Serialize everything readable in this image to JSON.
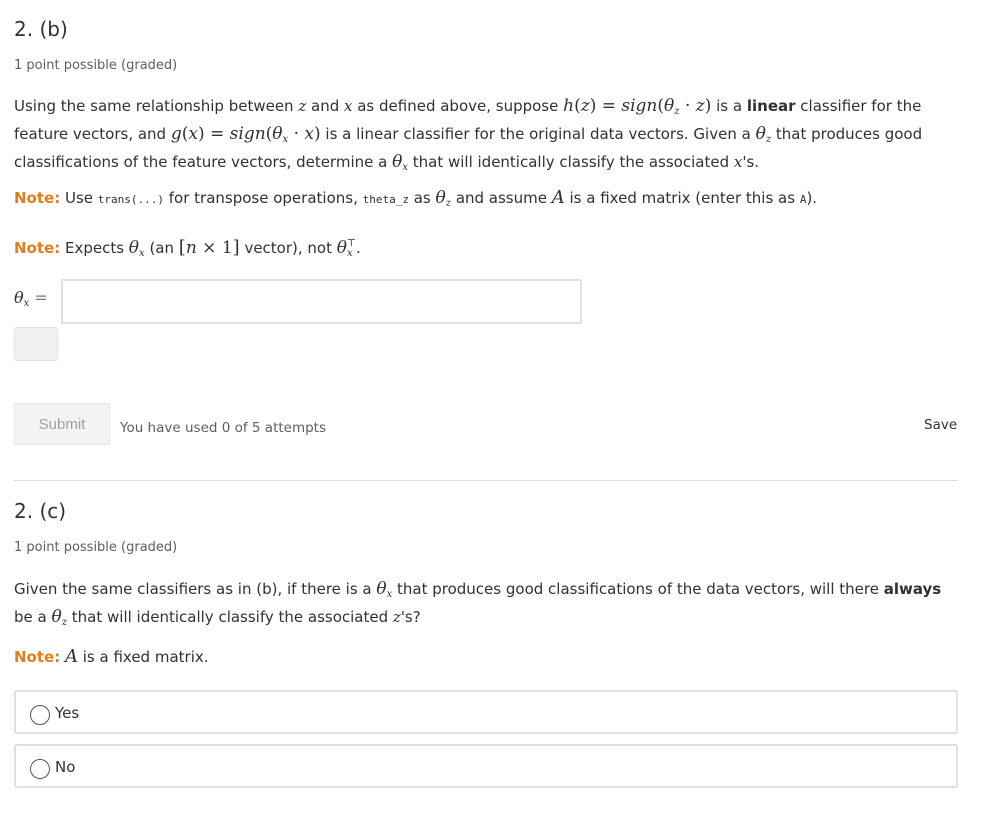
{
  "part_b": {
    "title": "2. (b)",
    "points": "1 point possible (graded)",
    "para": {
      "t1": "Using the same relationship between ",
      "t2": " and ",
      "t3": " as defined above, suppose ",
      "t4": " is a ",
      "bold1": "linear",
      "t5": " classifier for the feature vectors, and ",
      "t6": " is a linear classifier for the original data vectors. Given a ",
      "t7": " that produces good classifications of the feature vectors, determine a ",
      "t8": " that will identically classify the associated ",
      "t9": "'s."
    },
    "note1": {
      "label": "Note:",
      "t1": " Use ",
      "code1": "trans(...)",
      "t2": " for transpose operations, ",
      "code2": "theta_z",
      "t3": " as ",
      "t4": " and assume ",
      "t5": " is a fixed matrix (enter this as ",
      "code3": "A",
      "t6": ")."
    },
    "note2": {
      "label": "Note:",
      "t1": " Expects ",
      "t2": " (an ",
      "t3": " vector), not ",
      "t4": "."
    },
    "input": {
      "value": "",
      "placeholder": ""
    },
    "submit_label": "Submit",
    "attempts": "You have used 0 of 5 attempts",
    "save_label": "Save"
  },
  "part_c": {
    "title": "2. (c)",
    "points": "1 point possible (graded)",
    "para": {
      "t1": "Given the same classifiers as in (b), if there is a ",
      "t2": " that produces good classifications of the data vectors, will there ",
      "bold1": "always",
      "t3": " be a ",
      "t4": " that will identically classify the associated ",
      "t5": "'s?"
    },
    "note": {
      "label": "Note:",
      "t1": " is a fixed matrix."
    },
    "choices": [
      {
        "label": "Yes",
        "selected": false
      },
      {
        "label": "No",
        "selected": false
      }
    ]
  },
  "colors": {
    "note": "#e37c1a",
    "text": "#313131",
    "muted": "#5e5e5e",
    "border": "#e0e0e0"
  }
}
